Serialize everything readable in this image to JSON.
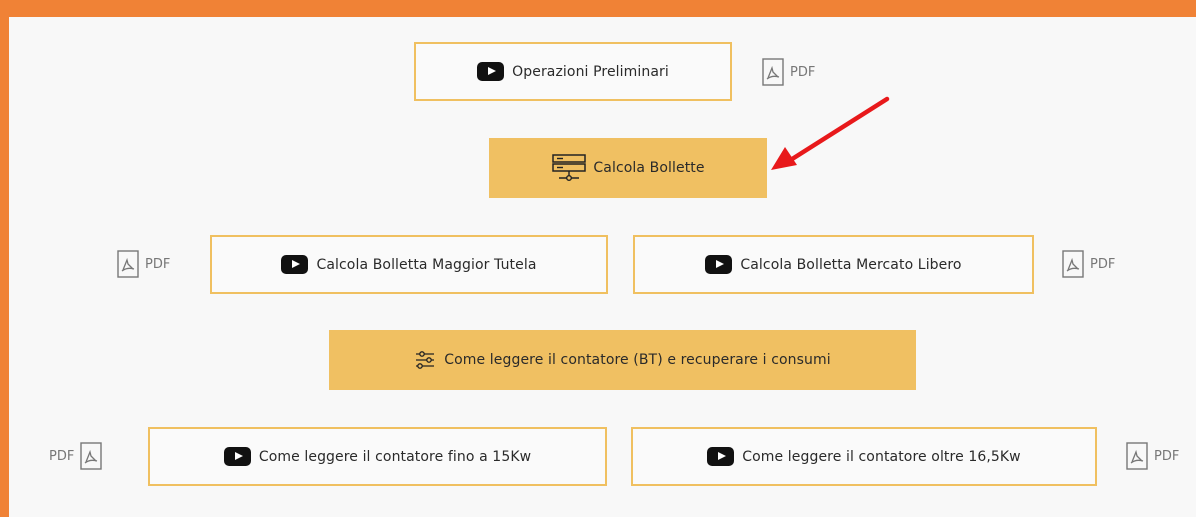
{
  "pdf_label": "PDF",
  "buttons": {
    "operazioni": "Operazioni Preliminari",
    "calcola_bollette": "Calcola Bollette",
    "maggior_tutela": "Calcola Bolletta Maggior Tutela",
    "mercato_libero": "Calcola Bolletta Mercato Libero",
    "come_leggere": "Come leggere il contatore (BT) e recuperare i consumi",
    "fino_15": "Come leggere il contatore fino a 15Kw",
    "oltre_16": "Come leggere il contatore oltre 16,5Kw"
  },
  "colors": {
    "frame": "#f08236",
    "outline": "#f0c060",
    "filled": "#f0c062",
    "arrow": "#e8191b"
  },
  "icons": {
    "video": "youtube-play-icon",
    "pdf": "pdf-file-icon",
    "server": "server-icon",
    "sliders": "sliders-icon"
  }
}
